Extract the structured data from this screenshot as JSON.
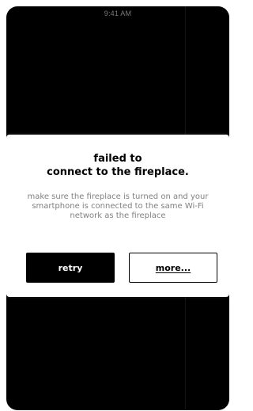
{
  "status_bar": {
    "time": "9:41 AM"
  },
  "dialog": {
    "title_line1": "failed to",
    "title_line2": "connect to the fireplace.",
    "message": "make sure the fireplace is turned on and your smartphone is connected to the same Wi-Fi network as the fireplace",
    "retry_label": "retry",
    "more_label": "more..."
  },
  "colors": {
    "background": "#000000",
    "dialog_background": "#ffffff",
    "primary_button": "#000000",
    "message_text": "#808080"
  }
}
